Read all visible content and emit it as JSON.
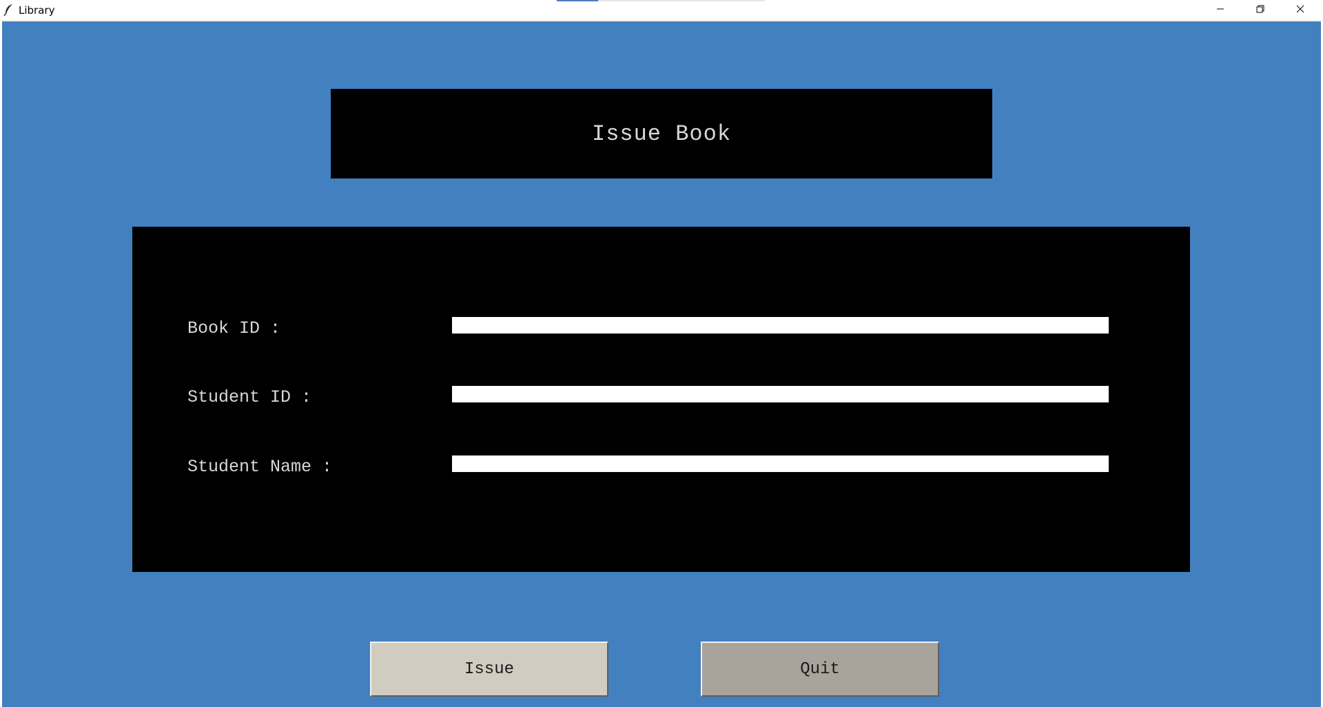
{
  "window": {
    "title": "Library",
    "icon": "feather-icon",
    "controls": [
      "minimize-icon",
      "restore-icon",
      "close-icon"
    ]
  },
  "colors": {
    "background": "#4380c0",
    "panel": "#000000",
    "label_text": "#d8d8d8",
    "issue_button": "#d0ccc0",
    "quit_button": "#a8a39b"
  },
  "heading": {
    "text": "Issue Book"
  },
  "form": {
    "fields": [
      {
        "label": "Book ID :",
        "value": "",
        "placeholder": ""
      },
      {
        "label": "Student ID :",
        "value": "",
        "placeholder": ""
      },
      {
        "label": "Student Name :",
        "value": "",
        "placeholder": ""
      }
    ]
  },
  "buttons": {
    "issue_label": "Issue",
    "quit_label": "Quit"
  }
}
